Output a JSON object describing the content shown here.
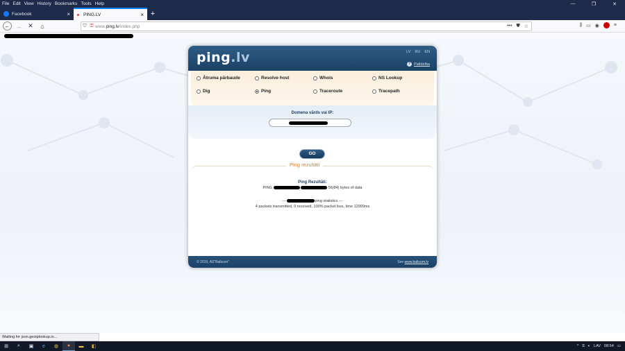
{
  "menu": [
    "File",
    "Edit",
    "View",
    "History",
    "Bookmarks",
    "Tools",
    "Help"
  ],
  "window_controls": {
    "minimize": "—",
    "restore": "❐",
    "close": "✕"
  },
  "tabs": [
    {
      "title": "Facebook",
      "favicon_color": "#1877f2"
    },
    {
      "title": "PING.LV",
      "favicon_color": "#d14a3b"
    }
  ],
  "new_tab": "+",
  "url": {
    "prefix": "www.",
    "host": "ping.lv",
    "path": "/index.php",
    "page_actions": "•••"
  },
  "nav_icons": [
    "back-icon",
    "forward-icon",
    "stop-icon",
    "home-icon"
  ],
  "page": {
    "logo_main": "ping",
    "logo_tld": ".lv",
    "languages": [
      "LV",
      "RU",
      "EN"
    ],
    "help_label": "Palīdzība",
    "options": [
      {
        "label": "Ātruma pārbaude",
        "selected": false
      },
      {
        "label": "Resolve host",
        "selected": false
      },
      {
        "label": "Whois",
        "selected": false
      },
      {
        "label": "NS Lookup",
        "selected": false
      },
      {
        "label": "Dig",
        "selected": false
      },
      {
        "label": "Ping",
        "selected": true
      },
      {
        "label": "Traceroute",
        "selected": false
      },
      {
        "label": "Tracepath",
        "selected": false
      }
    ],
    "domain_label": "Domena vārds vai IP:",
    "go_label": "GO",
    "results_tab": "Ping rezultāti",
    "results_title": "Ping Rezultāti:",
    "ping_prefix": "PING",
    "ping_suffix": "56(84) bytes of data",
    "stats_prefix": "---",
    "stats_suffix": "ping statistics ---",
    "stats_summary": "4 packets transmitted, 0 received, 100% packet loss, time 12999ms",
    "footer_copy": "© 2019, AS\"Baltcom\"",
    "footer_see": "See",
    "footer_link": "www.baltcom.lv"
  },
  "status_text": "Waiting for json.geoiplookup.io...",
  "taskbar": {
    "tray_language": "LAV",
    "clock": "08:54"
  }
}
